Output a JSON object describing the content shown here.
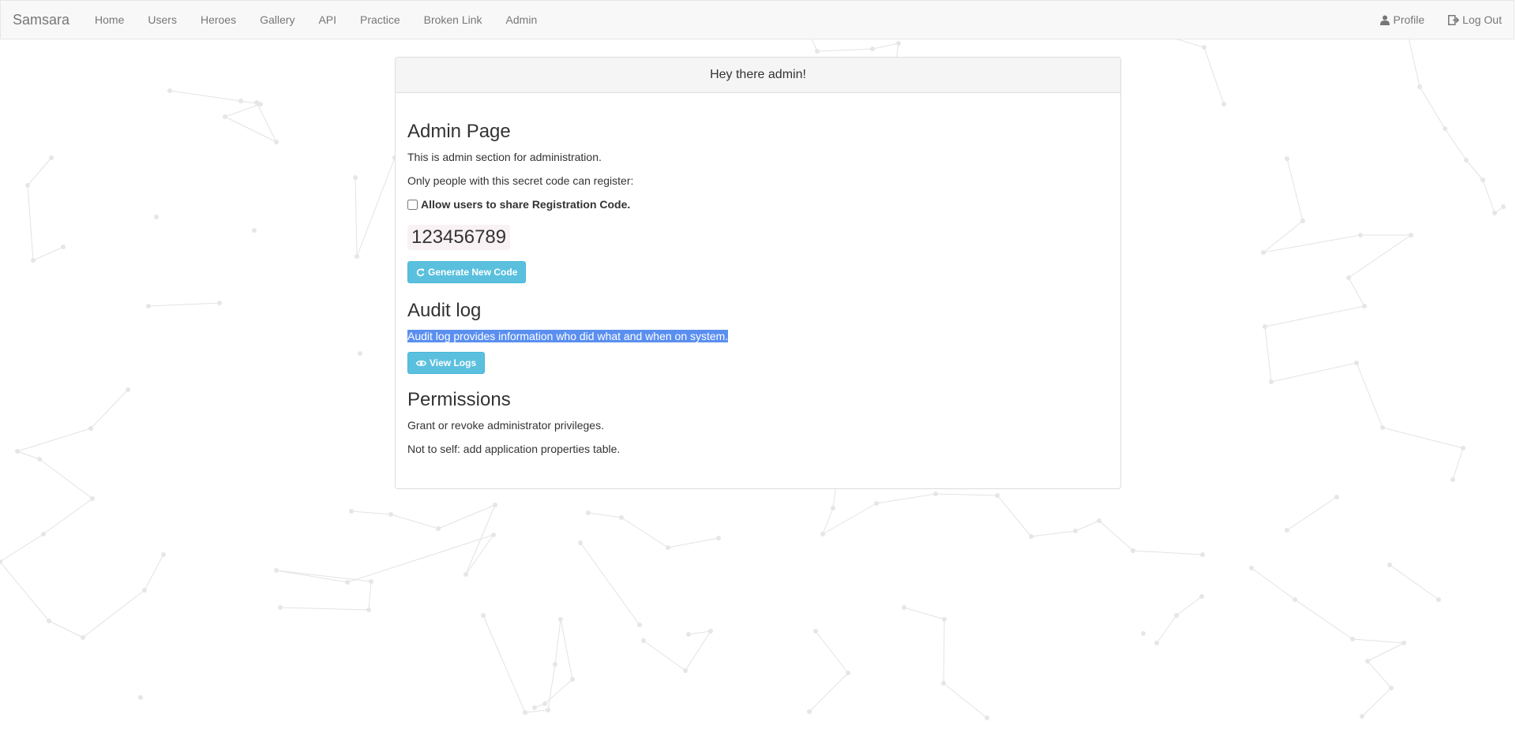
{
  "navbar": {
    "brand": "Samsara",
    "items": [
      "Home",
      "Users",
      "Heroes",
      "Gallery",
      "API",
      "Practice",
      "Broken Link",
      "Admin"
    ],
    "profile_label": "Profile",
    "logout_label": "Log Out"
  },
  "panel": {
    "heading": "Hey there admin!",
    "admin": {
      "title": "Admin Page",
      "desc": "This is admin section for administration.",
      "secret_note": "Only people with this secret code can register:",
      "share_checkbox_label": "Allow users to share Registration Code.",
      "share_checked": false,
      "code": "123456789",
      "generate_button": "Generate New Code"
    },
    "audit": {
      "title": "Audit log",
      "desc": "Audit log provides information who did what and when on system.",
      "view_button": "View Logs"
    },
    "permissions": {
      "title": "Permissions",
      "desc": "Grant or revoke administrator privileges.",
      "note": "Not to self: add application properties table."
    }
  },
  "colors": {
    "navbar_bg": "#f8f8f8",
    "button_info": "#5bc0de",
    "selection": "#5a8ff0"
  }
}
